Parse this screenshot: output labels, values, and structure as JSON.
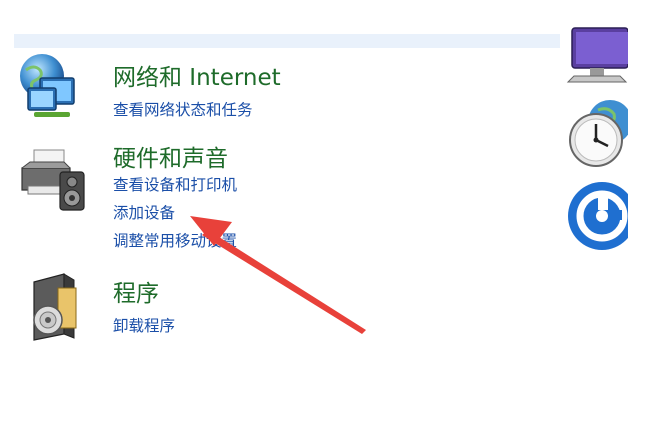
{
  "categories": [
    {
      "id": "network",
      "title": "网络和 Internet",
      "links": [
        "查看网络状态和任务"
      ]
    },
    {
      "id": "hardware",
      "title": "硬件和声音",
      "links": [
        "查看设备和打印机",
        "添加设备",
        "调整常用移动设置"
      ]
    },
    {
      "id": "programs",
      "title": "程序",
      "links": [
        "卸载程序"
      ]
    }
  ],
  "colors": {
    "title": "#1e6b2a",
    "link": "#1b4fa8",
    "arrow": "#e8413a",
    "top_strip": "#e9f1fb"
  },
  "icons": {
    "network": "network-globe-monitors-icon",
    "hardware": "printer-speaker-icon",
    "programs": "program-disc-box-icon",
    "right_side": [
      "appearance-monitor-icon",
      "clock-globe-icon",
      "ease-of-access-icon"
    ]
  },
  "annotation": "red-arrow-pointing-at-add-device"
}
